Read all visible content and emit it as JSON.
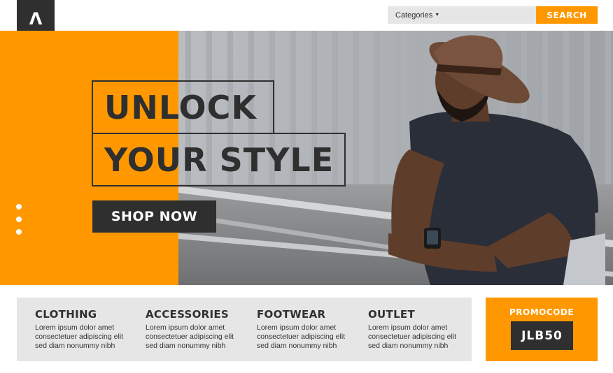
{
  "logo": {
    "glyph": "Λ"
  },
  "search": {
    "categories_label": "Categories",
    "caret": "▼",
    "button_label": "SEARCH"
  },
  "hero": {
    "headline_line1": "UNLOCK",
    "headline_line2": "YOUR STYLE",
    "cta_label": "SHOP NOW",
    "slide_dots": 3
  },
  "categories": [
    {
      "title": "CLOTHING",
      "desc_line1": "Lorem ipsum dolor amet",
      "desc_line2": "consectetuer adipiscing elit",
      "desc_line3": "sed diam nonummy nibh"
    },
    {
      "title": "ACCESSORIES",
      "desc_line1": "Lorem ipsum dolor amet",
      "desc_line2": "consectetuer adipiscing elit",
      "desc_line3": "sed diam nonummy nibh"
    },
    {
      "title": "FOOTWEAR",
      "desc_line1": "Lorem ipsum dolor amet",
      "desc_line2": "consectetuer adipiscing elit",
      "desc_line3": "sed diam nonummy nibh"
    },
    {
      "title": "OUTLET",
      "desc_line1": "Lorem ipsum dolor amet",
      "desc_line2": "consectetuer adipiscing elit",
      "desc_line3": "sed diam nonummy nibh"
    }
  ],
  "promo": {
    "label": "PROMOCODE",
    "code": "JLB50"
  },
  "colors": {
    "accent": "#ff9800",
    "dark": "#2f2f2f",
    "panel": "#e6e6e6"
  }
}
